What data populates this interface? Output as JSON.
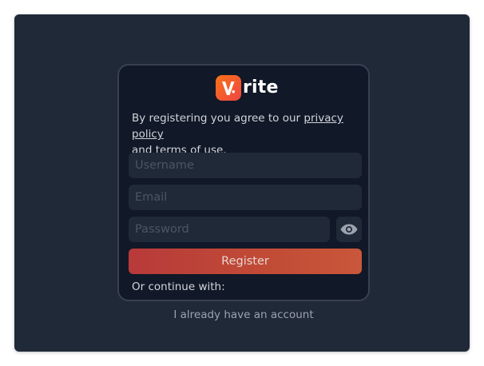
{
  "logo": {
    "text": "rite",
    "mark_letter": "V",
    "gradient_start": "#f97316",
    "gradient_end": "#ef4444"
  },
  "terms": {
    "prefix": "By registering you agree to our ",
    "privacy_link": "privacy policy",
    "middle": "and ",
    "terms_link": "terms of use",
    "suffix": "."
  },
  "form": {
    "username_placeholder": "Username",
    "email_placeholder": "Email",
    "password_placeholder": "Password",
    "password_toggle_icon": "eye-icon",
    "register_label": "Register"
  },
  "continue_with": "Or continue with:",
  "account_link": "I already have an account",
  "colors": {
    "background": "#1f2937",
    "card": "#111827",
    "card_border": "#374151",
    "input": "#1f2937",
    "accent_gradient": [
      "#b83a3a",
      "#c9573a"
    ]
  }
}
